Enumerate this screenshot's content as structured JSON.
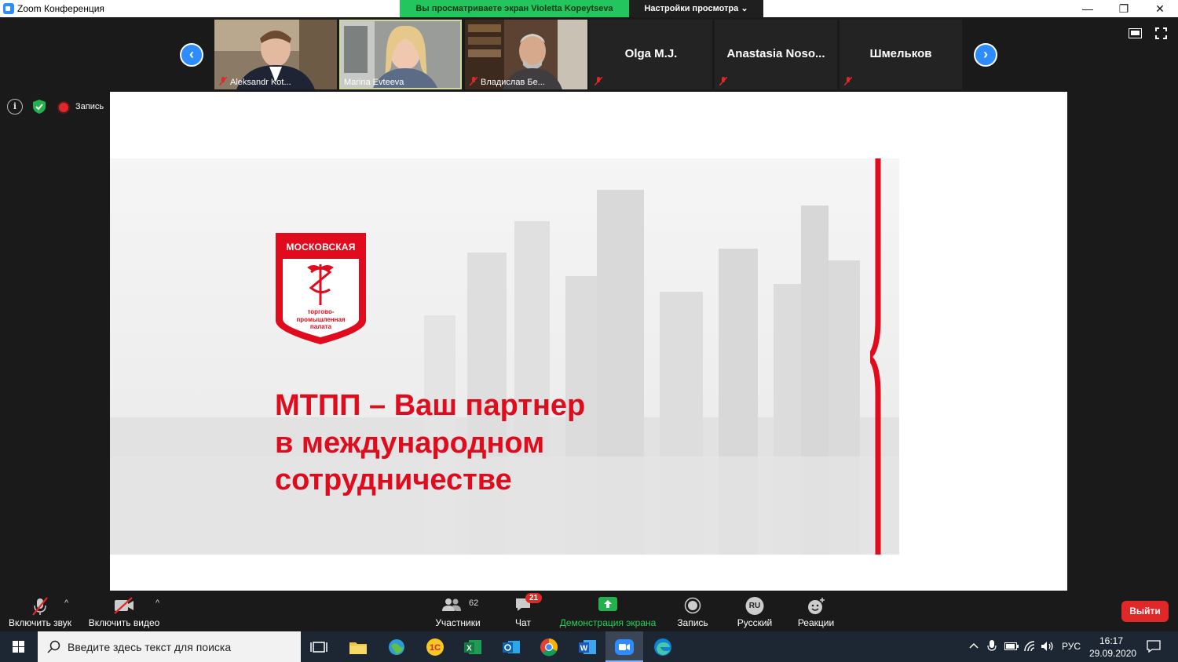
{
  "window": {
    "title": "Zoom Конференция",
    "share_banner": "Вы просматриваете экран Violetta Kopeytseva",
    "view_settings": "Настройки просмотра ⌄",
    "minimize": "—",
    "maximize": "❐",
    "close": "✕"
  },
  "participants_strip": {
    "tiles": [
      {
        "label": "Aleksandr Kot..."
      },
      {
        "label": "Marina Evteeva"
      },
      {
        "label": "Владислав Бе..."
      },
      {
        "name": "Olga M.J."
      },
      {
        "name": "Anastasia  Noso..."
      },
      {
        "name": "Шмельков"
      }
    ],
    "prev": "‹",
    "next": "›"
  },
  "status": {
    "info": "i",
    "recording_label": "Запись"
  },
  "slide": {
    "logo_top": "МОСКОВСКАЯ",
    "logo_bottom_1": "торгово-",
    "logo_bottom_2": "промышленная",
    "logo_bottom_3": "палата",
    "headline_line1": "МТПП  – Ваш  партнер",
    "headline_line2": "в международном",
    "headline_line3": "сотрудничестве",
    "accent_color": "#e00b1c"
  },
  "controls": {
    "audio": "Включить звук",
    "video": "Включить видео",
    "participants": "Участники",
    "participants_count": "62",
    "chat": "Чат",
    "chat_badge": "21",
    "share": "Демонстрация экрана",
    "record": "Запись",
    "language": "Русский",
    "language_code": "RU",
    "reactions": "Реакции",
    "leave": "Выйти",
    "caret": "^"
  },
  "taskbar": {
    "search_placeholder": "Введите здесь текст для поиска",
    "lang": "РУС",
    "time": "16:17",
    "date": "29.09.2020"
  }
}
